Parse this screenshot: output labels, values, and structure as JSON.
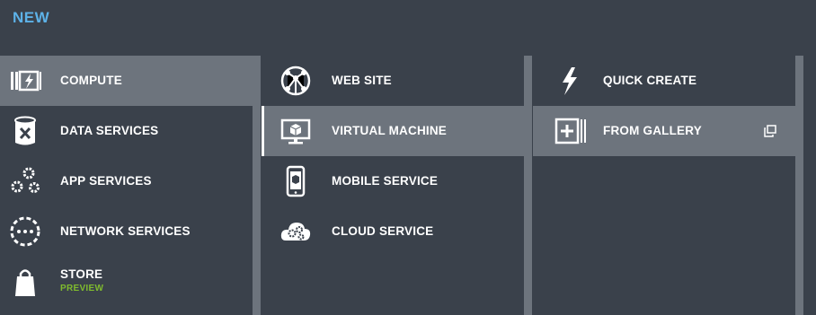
{
  "header": {
    "title": "NEW"
  },
  "columns": {
    "categories": [
      {
        "label": "COMPUTE",
        "icon": "compute-icon",
        "selected": true
      },
      {
        "label": "DATA SERVICES",
        "icon": "data-services-icon"
      },
      {
        "label": "APP SERVICES",
        "icon": "app-services-icon"
      },
      {
        "label": "NETWORK SERVICES",
        "icon": "network-services-icon"
      },
      {
        "label": "STORE",
        "sublabel": "PREVIEW",
        "icon": "store-icon"
      }
    ],
    "compute": [
      {
        "label": "WEB SITE",
        "icon": "web-site-icon"
      },
      {
        "label": "VIRTUAL MACHINE",
        "icon": "virtual-machine-icon",
        "selected": true
      },
      {
        "label": "MOBILE SERVICE",
        "icon": "mobile-service-icon"
      },
      {
        "label": "CLOUD SERVICE",
        "icon": "cloud-service-icon"
      }
    ],
    "vm_options": [
      {
        "label": "QUICK CREATE",
        "icon": "lightning-icon"
      },
      {
        "label": "FROM GALLERY",
        "icon": "gallery-icon",
        "selected": true,
        "action_icon": "popout-icon"
      }
    ]
  },
  "colors": {
    "background": "#3a414b",
    "selected": "#6d747d",
    "title": "#5db2e8",
    "preview": "#7fbb2e"
  }
}
